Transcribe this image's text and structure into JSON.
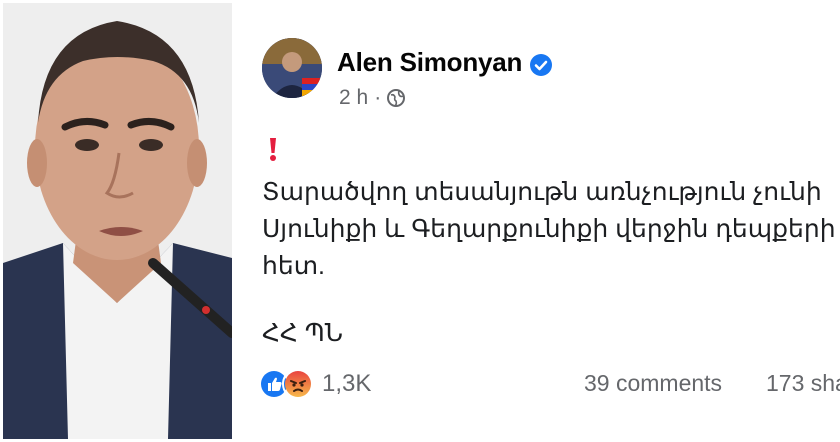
{
  "post": {
    "author": "Alen Simonyan",
    "time": "2 h",
    "separator": "·",
    "alert_icon": "exclamation-icon",
    "body_lines": [
      "Տարածվող տեսանյութն առնչություն չունի",
      "Սյունիքի և Գեղարքունիքի վերջին դեպքերի",
      "հետ."
    ],
    "signature": "ՀՀ ՊՆ",
    "reactions": {
      "icons": [
        "like-icon",
        "angry-icon"
      ],
      "count": "1,3K"
    },
    "comments": "39 comments",
    "shares": "173 sha"
  },
  "colors": {
    "verified": "#1877f2",
    "like": "#1877f2",
    "angry": "#f7714a",
    "alert": "#e41e3f",
    "secondary_text": "#65676b"
  }
}
